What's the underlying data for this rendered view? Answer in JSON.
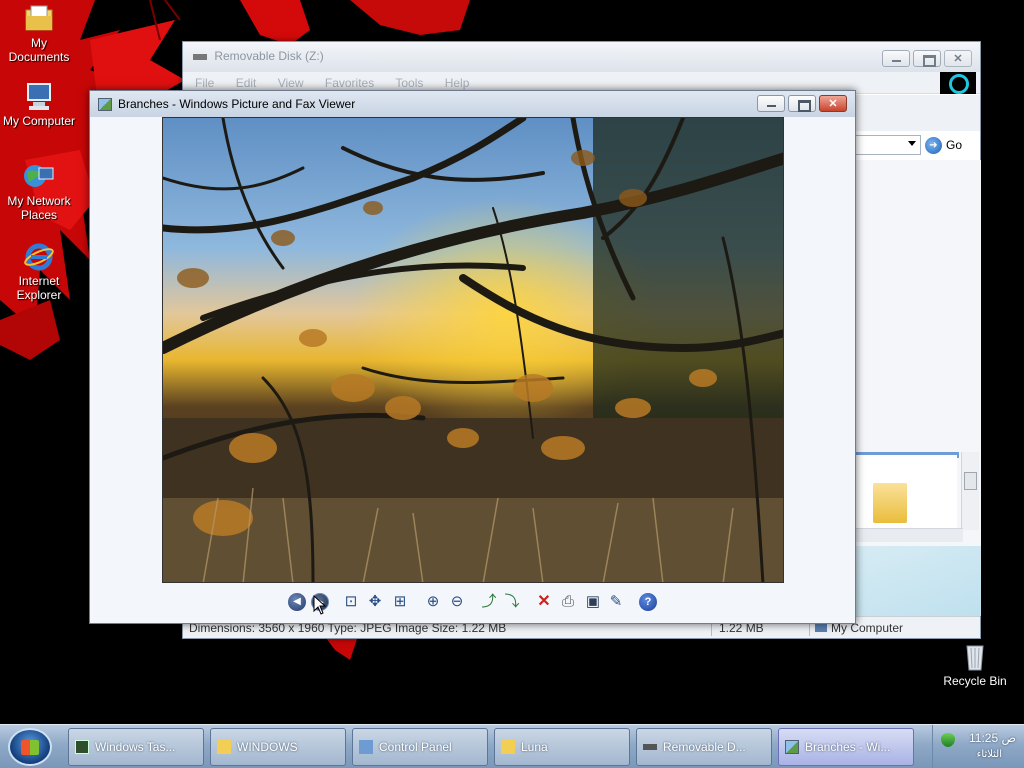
{
  "desktop": {
    "icons": [
      {
        "label": "My Documents"
      },
      {
        "label": "My Computer"
      },
      {
        "label": "My Network Places"
      },
      {
        "label": "Internet Explorer"
      },
      {
        "label": "Recycle Bin"
      }
    ]
  },
  "explorer": {
    "title": "Removable Disk (Z:)",
    "menu": [
      "File",
      "Edit",
      "View",
      "Favorites",
      "Tools",
      "Help"
    ],
    "go_label": "Go",
    "status": {
      "details": "Dimensions: 3560 x 1960 Type: JPEG Image Size: 1.22 MB",
      "size": "1.22 MB",
      "location": "My Computer"
    }
  },
  "viewer": {
    "title": "Branches - Windows Picture and Fax Viewer",
    "toolbar": [
      {
        "icon": "previous-image-icon",
        "glyph": "◀"
      },
      {
        "icon": "next-image-icon",
        "glyph": "▶"
      },
      {
        "icon": "best-fit-icon",
        "glyph": "⊡"
      },
      {
        "icon": "actual-size-icon",
        "glyph": "✥"
      },
      {
        "icon": "slide-show-icon",
        "glyph": "⊞"
      },
      {
        "icon": "zoom-in-icon",
        "glyph": "⊕"
      },
      {
        "icon": "zoom-out-icon",
        "glyph": "⊖"
      },
      {
        "icon": "rotate-clockwise-icon",
        "glyph": "⤴"
      },
      {
        "icon": "rotate-counterclockwise-icon",
        "glyph": "⤵"
      },
      {
        "icon": "delete-icon",
        "glyph": "✕"
      },
      {
        "icon": "print-icon",
        "glyph": "⎙"
      },
      {
        "icon": "save-copy-icon",
        "glyph": "▣"
      },
      {
        "icon": "edit-icon",
        "glyph": "✎"
      },
      {
        "icon": "help-icon",
        "glyph": "?"
      }
    ]
  },
  "taskbar": {
    "tasks": [
      {
        "label": "Windows Tas..."
      },
      {
        "label": "WINDOWS"
      },
      {
        "label": "Control Panel"
      },
      {
        "label": "Luna"
      },
      {
        "label": "Removable D..."
      },
      {
        "label": "Branches - Wi..."
      }
    ],
    "clock": {
      "time": "11:25 ص",
      "day": "الثلاثاء"
    }
  }
}
